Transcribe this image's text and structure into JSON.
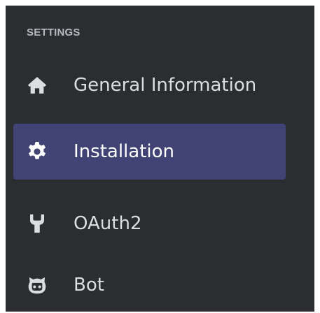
{
  "settings": {
    "header": "SETTINGS",
    "items": [
      {
        "label": "General Information",
        "icon": "home-icon",
        "active": false
      },
      {
        "label": "Installation",
        "icon": "gear-icon",
        "active": true
      },
      {
        "label": "OAuth2",
        "icon": "wrench-icon",
        "active": false
      },
      {
        "label": "Bot",
        "icon": "bot-icon",
        "active": false
      }
    ]
  },
  "colors": {
    "panel_background": "#2b2d31",
    "active_background": "#404373",
    "text": "#dbdee1",
    "header_text": "#b5bac1"
  }
}
